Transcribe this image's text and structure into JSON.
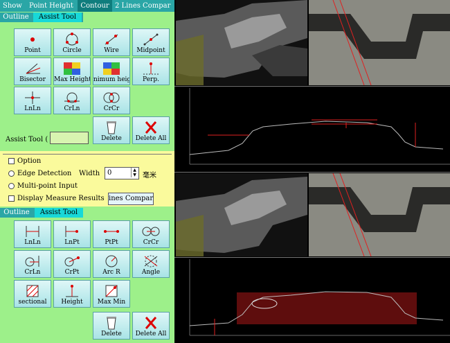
{
  "topnav": {
    "items": [
      "Show",
      "Point Height",
      "Contour",
      "2 Lines Compar"
    ]
  },
  "assist_tabs_1": {
    "outline": "Outline",
    "assist": "Assist Tool"
  },
  "tools_1": [
    {
      "label": "Point",
      "icon": "point-icon"
    },
    {
      "label": "Circle",
      "icon": "circle-icon"
    },
    {
      "label": "Wire",
      "icon": "wire-icon"
    },
    {
      "label": "Midpoint",
      "icon": "midpoint-icon"
    },
    {
      "label": "Bisector",
      "icon": "bisector-icon"
    },
    {
      "label": "Max Height",
      "icon": "max-height-icon"
    },
    {
      "label": "nimum heig",
      "icon": "min-height-icon"
    },
    {
      "label": "Perp.",
      "icon": "perpendicular-icon"
    },
    {
      "label": "LnLn",
      "icon": "line-line-icon"
    },
    {
      "label": "CrLn",
      "icon": "circle-line-icon"
    },
    {
      "label": "CrCr",
      "icon": "circle-circle-icon"
    }
  ],
  "assist_tool_label": "Assist Tool (",
  "delete_label": "Delete",
  "delete_all_label": "Delete All",
  "options": {
    "option": "Option",
    "edge_detection": "Edge Detection",
    "width_label": "Width",
    "width_value": "0",
    "unit": "毫米",
    "multipoint": "Multi-point Input",
    "display_results": "Display Measure Results",
    "lines_compare": "ines Compari"
  },
  "assist_tabs_2": {
    "outline": "Outline",
    "assist": "Assist Tool"
  },
  "tools_2": [
    {
      "label": "LnLn",
      "icon": "line-line-measure-icon"
    },
    {
      "label": "LnPt",
      "icon": "line-point-icon"
    },
    {
      "label": "PtPt",
      "icon": "point-point-icon"
    },
    {
      "label": "CrCr",
      "icon": "circle-circle-measure-icon"
    },
    {
      "label": "CrLn",
      "icon": "circle-line-measure-icon"
    },
    {
      "label": "CrPt",
      "icon": "circle-point-icon"
    },
    {
      "label": "Arc R",
      "icon": "arc-radius-icon"
    },
    {
      "label": "Angle",
      "icon": "angle-icon"
    },
    {
      "label": "sectional",
      "icon": "sectional-icon"
    },
    {
      "label": "Height",
      "icon": "height-icon"
    },
    {
      "label": "Max Min",
      "icon": "max-min-icon"
    }
  ],
  "colors": {
    "panel": "#9df08a",
    "nav": "#2aa6a6",
    "active_tab": "#18d8d8",
    "options_bg": "#fafa9c"
  }
}
